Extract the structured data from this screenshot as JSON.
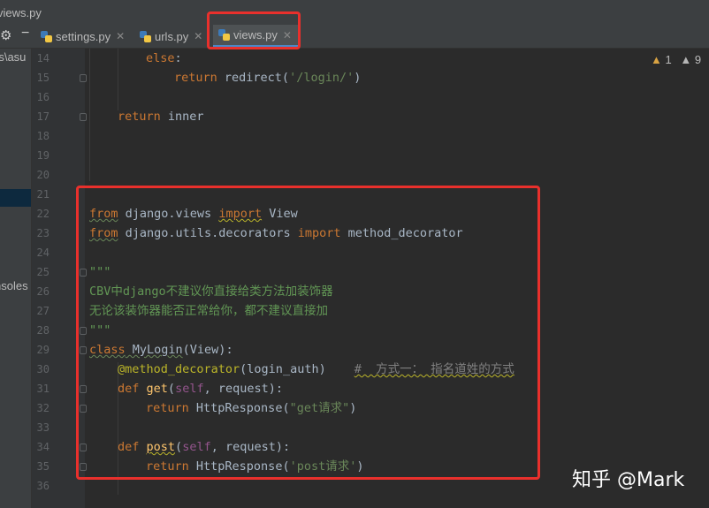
{
  "window": {
    "title": "views.py"
  },
  "tabs": [
    {
      "label": "settings.py",
      "active": false
    },
    {
      "label": "urls.py",
      "active": false
    },
    {
      "label": "views.py",
      "active": true
    }
  ],
  "sidebar": {
    "path": "rs\\asu",
    "consoles": "nsoles"
  },
  "inspections": {
    "warnings": "1",
    "weak_warnings": "9"
  },
  "line_numbers": [
    "14",
    "15",
    "16",
    "17",
    "18",
    "19",
    "20",
    "21",
    "22",
    "23",
    "24",
    "25",
    "26",
    "27",
    "28",
    "29",
    "30",
    "31",
    "32",
    "33",
    "34",
    "35",
    "36"
  ],
  "code": {
    "l14": {
      "else": "else",
      "colon": ":"
    },
    "l15": {
      "return": "return",
      "call": " redirect(",
      "arg": "'/login/'",
      "end": ")"
    },
    "l17": {
      "return": "return",
      "rest": " inner"
    },
    "l22": {
      "from": "from",
      "mod": " django.views ",
      "import": "import",
      "name": " View"
    },
    "l23": {
      "from": "from",
      "mod": " django.utils.decorators ",
      "import": "import",
      "name": " method_decorator"
    },
    "l25": {
      "doc": "\"\"\""
    },
    "l26": {
      "doc": "CBV中django不建议你直接给类方法加装饰器"
    },
    "l27": {
      "doc": "无论该装饰器能否正常给你，都不建议直接加"
    },
    "l28": {
      "doc": "\"\"\""
    },
    "l29": {
      "class": "class",
      "name": " MyLogin",
      "rest": "(View):"
    },
    "l30": {
      "deco": "@method_decorator",
      "args": "(login_auth)",
      "comment": "#  方式一： 指名道姓的方式"
    },
    "l31": {
      "def": "def",
      "fname": "get",
      "open": "(",
      "self": "self",
      "rest": ", request):"
    },
    "l32": {
      "return": "return",
      "call": " HttpResponse(",
      "arg": "\"get请求\"",
      "end": ")"
    },
    "l34": {
      "def": "def",
      "fname": "post",
      "open": "(",
      "self": "self",
      "rest": ", request):"
    },
    "l35": {
      "return": "return",
      "call": " HttpResponse(",
      "arg": "'post请求'",
      "end": ")"
    }
  },
  "watermark": "知乎 @Mark"
}
